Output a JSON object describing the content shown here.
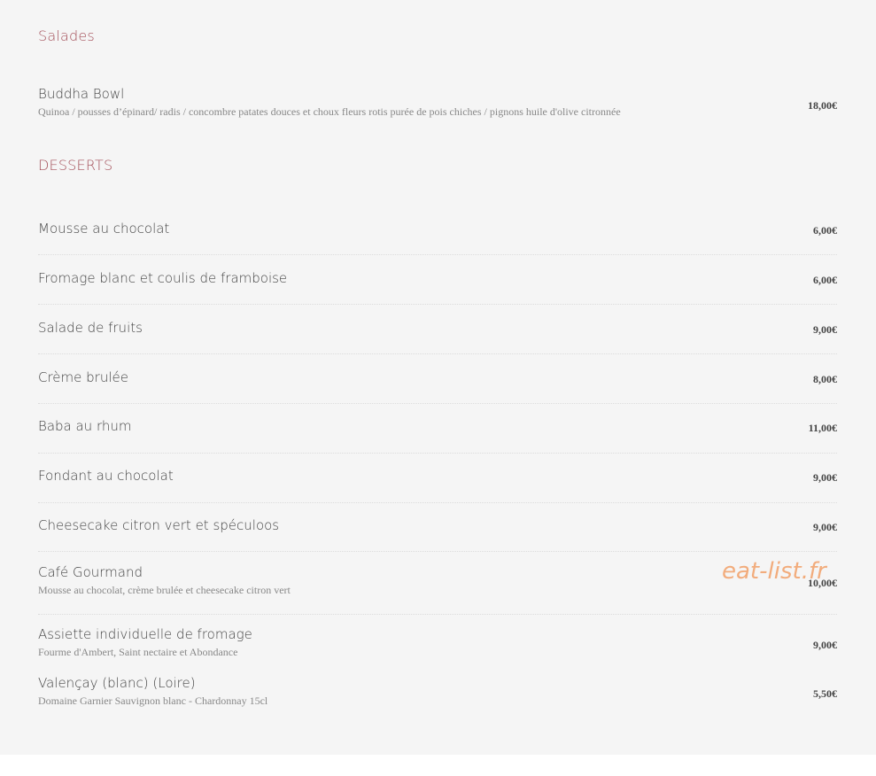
{
  "sections": {
    "salades": {
      "title": "Salades",
      "items": [
        {
          "name": "Buddha Bowl",
          "description": "Quinoa / pousses d’épinard/ radis / concombre patates douces et choux fleurs rotis purée de pois chiches / pignons huile d'olive citronnée",
          "price": "18,00€"
        }
      ]
    },
    "desserts": {
      "title": "DESSERTS",
      "items": [
        {
          "name": "Mousse au chocolat",
          "price": "6,00€"
        },
        {
          "name": "Fromage blanc et coulis de framboise",
          "price": "6,00€"
        },
        {
          "name": "Salade de fruits",
          "price": "9,00€"
        },
        {
          "name": "Crème brulée",
          "price": "8,00€"
        },
        {
          "name": "Baba au rhum",
          "price": "11,00€"
        },
        {
          "name": "Fondant au chocolat",
          "price": "9,00€"
        },
        {
          "name": "Cheesecake citron vert et spéculoos",
          "price": "9,00€"
        },
        {
          "name": "Café Gourmand",
          "description": "Mousse au chocolat, crème brulée et cheesecake citron vert",
          "price": "10,00€"
        },
        {
          "name": "Assiette individuelle de fromage",
          "description": "Fourme d'Ambert, Saint nectaire et Abondance",
          "price": "9,00€"
        },
        {
          "name": "Valençay (blanc) (Loire)",
          "description": "Domaine Garnier Sauvignon blanc - Chardonnay 15cl",
          "price": "5,50€"
        }
      ]
    }
  },
  "watermark": "eat-list.fr"
}
